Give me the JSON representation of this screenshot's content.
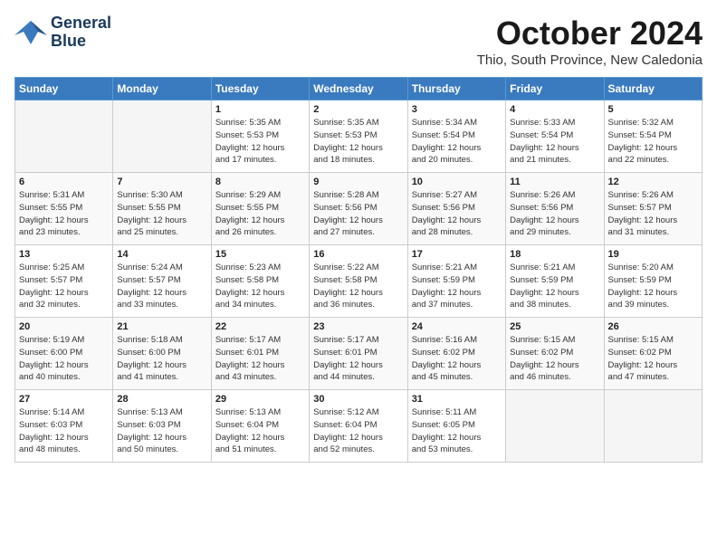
{
  "logo": {
    "line1": "General",
    "line2": "Blue"
  },
  "title": "October 2024",
  "subtitle": "Thio, South Province, New Caledonia",
  "headers": [
    "Sunday",
    "Monday",
    "Tuesday",
    "Wednesday",
    "Thursday",
    "Friday",
    "Saturday"
  ],
  "weeks": [
    [
      {
        "day": "",
        "info": ""
      },
      {
        "day": "",
        "info": ""
      },
      {
        "day": "1",
        "info": "Sunrise: 5:35 AM\nSunset: 5:53 PM\nDaylight: 12 hours\nand 17 minutes."
      },
      {
        "day": "2",
        "info": "Sunrise: 5:35 AM\nSunset: 5:53 PM\nDaylight: 12 hours\nand 18 minutes."
      },
      {
        "day": "3",
        "info": "Sunrise: 5:34 AM\nSunset: 5:54 PM\nDaylight: 12 hours\nand 20 minutes."
      },
      {
        "day": "4",
        "info": "Sunrise: 5:33 AM\nSunset: 5:54 PM\nDaylight: 12 hours\nand 21 minutes."
      },
      {
        "day": "5",
        "info": "Sunrise: 5:32 AM\nSunset: 5:54 PM\nDaylight: 12 hours\nand 22 minutes."
      }
    ],
    [
      {
        "day": "6",
        "info": "Sunrise: 5:31 AM\nSunset: 5:55 PM\nDaylight: 12 hours\nand 23 minutes."
      },
      {
        "day": "7",
        "info": "Sunrise: 5:30 AM\nSunset: 5:55 PM\nDaylight: 12 hours\nand 25 minutes."
      },
      {
        "day": "8",
        "info": "Sunrise: 5:29 AM\nSunset: 5:55 PM\nDaylight: 12 hours\nand 26 minutes."
      },
      {
        "day": "9",
        "info": "Sunrise: 5:28 AM\nSunset: 5:56 PM\nDaylight: 12 hours\nand 27 minutes."
      },
      {
        "day": "10",
        "info": "Sunrise: 5:27 AM\nSunset: 5:56 PM\nDaylight: 12 hours\nand 28 minutes."
      },
      {
        "day": "11",
        "info": "Sunrise: 5:26 AM\nSunset: 5:56 PM\nDaylight: 12 hours\nand 29 minutes."
      },
      {
        "day": "12",
        "info": "Sunrise: 5:26 AM\nSunset: 5:57 PM\nDaylight: 12 hours\nand 31 minutes."
      }
    ],
    [
      {
        "day": "13",
        "info": "Sunrise: 5:25 AM\nSunset: 5:57 PM\nDaylight: 12 hours\nand 32 minutes."
      },
      {
        "day": "14",
        "info": "Sunrise: 5:24 AM\nSunset: 5:57 PM\nDaylight: 12 hours\nand 33 minutes."
      },
      {
        "day": "15",
        "info": "Sunrise: 5:23 AM\nSunset: 5:58 PM\nDaylight: 12 hours\nand 34 minutes."
      },
      {
        "day": "16",
        "info": "Sunrise: 5:22 AM\nSunset: 5:58 PM\nDaylight: 12 hours\nand 36 minutes."
      },
      {
        "day": "17",
        "info": "Sunrise: 5:21 AM\nSunset: 5:59 PM\nDaylight: 12 hours\nand 37 minutes."
      },
      {
        "day": "18",
        "info": "Sunrise: 5:21 AM\nSunset: 5:59 PM\nDaylight: 12 hours\nand 38 minutes."
      },
      {
        "day": "19",
        "info": "Sunrise: 5:20 AM\nSunset: 5:59 PM\nDaylight: 12 hours\nand 39 minutes."
      }
    ],
    [
      {
        "day": "20",
        "info": "Sunrise: 5:19 AM\nSunset: 6:00 PM\nDaylight: 12 hours\nand 40 minutes."
      },
      {
        "day": "21",
        "info": "Sunrise: 5:18 AM\nSunset: 6:00 PM\nDaylight: 12 hours\nand 41 minutes."
      },
      {
        "day": "22",
        "info": "Sunrise: 5:17 AM\nSunset: 6:01 PM\nDaylight: 12 hours\nand 43 minutes."
      },
      {
        "day": "23",
        "info": "Sunrise: 5:17 AM\nSunset: 6:01 PM\nDaylight: 12 hours\nand 44 minutes."
      },
      {
        "day": "24",
        "info": "Sunrise: 5:16 AM\nSunset: 6:02 PM\nDaylight: 12 hours\nand 45 minutes."
      },
      {
        "day": "25",
        "info": "Sunrise: 5:15 AM\nSunset: 6:02 PM\nDaylight: 12 hours\nand 46 minutes."
      },
      {
        "day": "26",
        "info": "Sunrise: 5:15 AM\nSunset: 6:02 PM\nDaylight: 12 hours\nand 47 minutes."
      }
    ],
    [
      {
        "day": "27",
        "info": "Sunrise: 5:14 AM\nSunset: 6:03 PM\nDaylight: 12 hours\nand 48 minutes."
      },
      {
        "day": "28",
        "info": "Sunrise: 5:13 AM\nSunset: 6:03 PM\nDaylight: 12 hours\nand 50 minutes."
      },
      {
        "day": "29",
        "info": "Sunrise: 5:13 AM\nSunset: 6:04 PM\nDaylight: 12 hours\nand 51 minutes."
      },
      {
        "day": "30",
        "info": "Sunrise: 5:12 AM\nSunset: 6:04 PM\nDaylight: 12 hours\nand 52 minutes."
      },
      {
        "day": "31",
        "info": "Sunrise: 5:11 AM\nSunset: 6:05 PM\nDaylight: 12 hours\nand 53 minutes."
      },
      {
        "day": "",
        "info": ""
      },
      {
        "day": "",
        "info": ""
      }
    ]
  ]
}
